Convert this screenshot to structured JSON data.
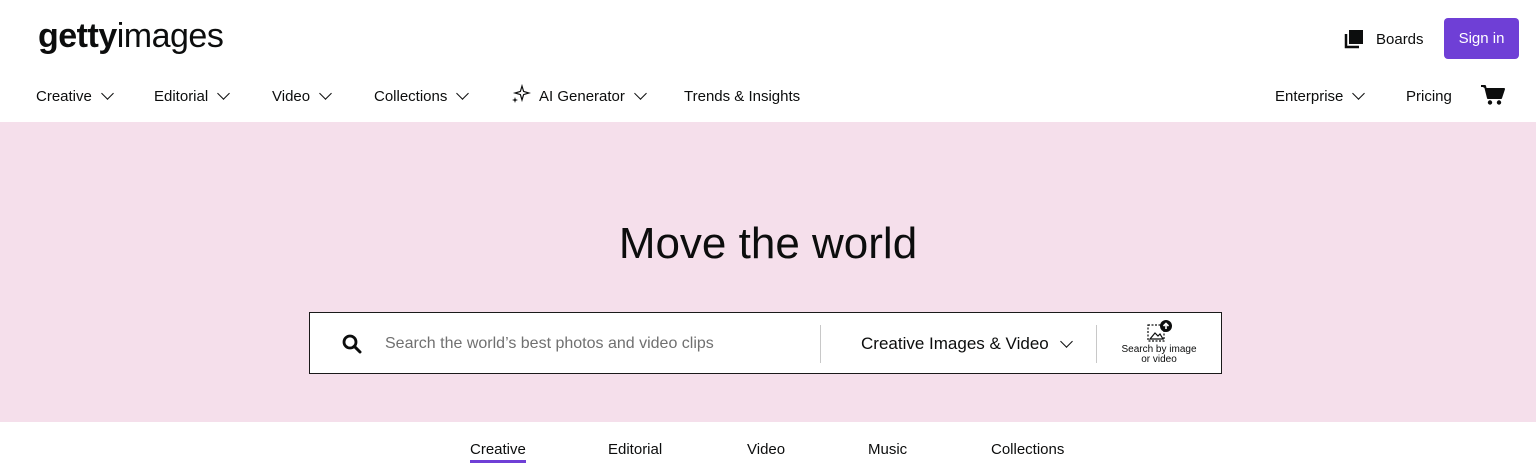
{
  "logo": {
    "bold": "getty",
    "light": "images"
  },
  "header": {
    "boards_label": "Boards",
    "signin_label": "Sign in",
    "accent_color": "#6f3fd6"
  },
  "nav": {
    "items": [
      {
        "label": "Creative",
        "has_dropdown": true
      },
      {
        "label": "Editorial",
        "has_dropdown": true
      },
      {
        "label": "Video",
        "has_dropdown": true
      },
      {
        "label": "Collections",
        "has_dropdown": true
      },
      {
        "label": "AI Generator",
        "has_dropdown": true,
        "icon": "sparkle-icon"
      },
      {
        "label": "Trends & Insights",
        "has_dropdown": false
      }
    ],
    "right_items": [
      {
        "label": "Enterprise",
        "has_dropdown": true
      },
      {
        "label": "Pricing",
        "has_dropdown": false
      }
    ],
    "cart_icon": "cart-icon"
  },
  "hero": {
    "title": "Move the world",
    "background_color": "#f5dfeb"
  },
  "search": {
    "placeholder": "Search the world’s best photos and video clips",
    "value": "",
    "type_selected": "Creative Images & Video",
    "image_search_line1": "Search by image",
    "image_search_line2": "or video"
  },
  "tabs": {
    "items": [
      "Creative",
      "Editorial",
      "Video",
      "Music",
      "Collections"
    ],
    "active": "Creative"
  }
}
